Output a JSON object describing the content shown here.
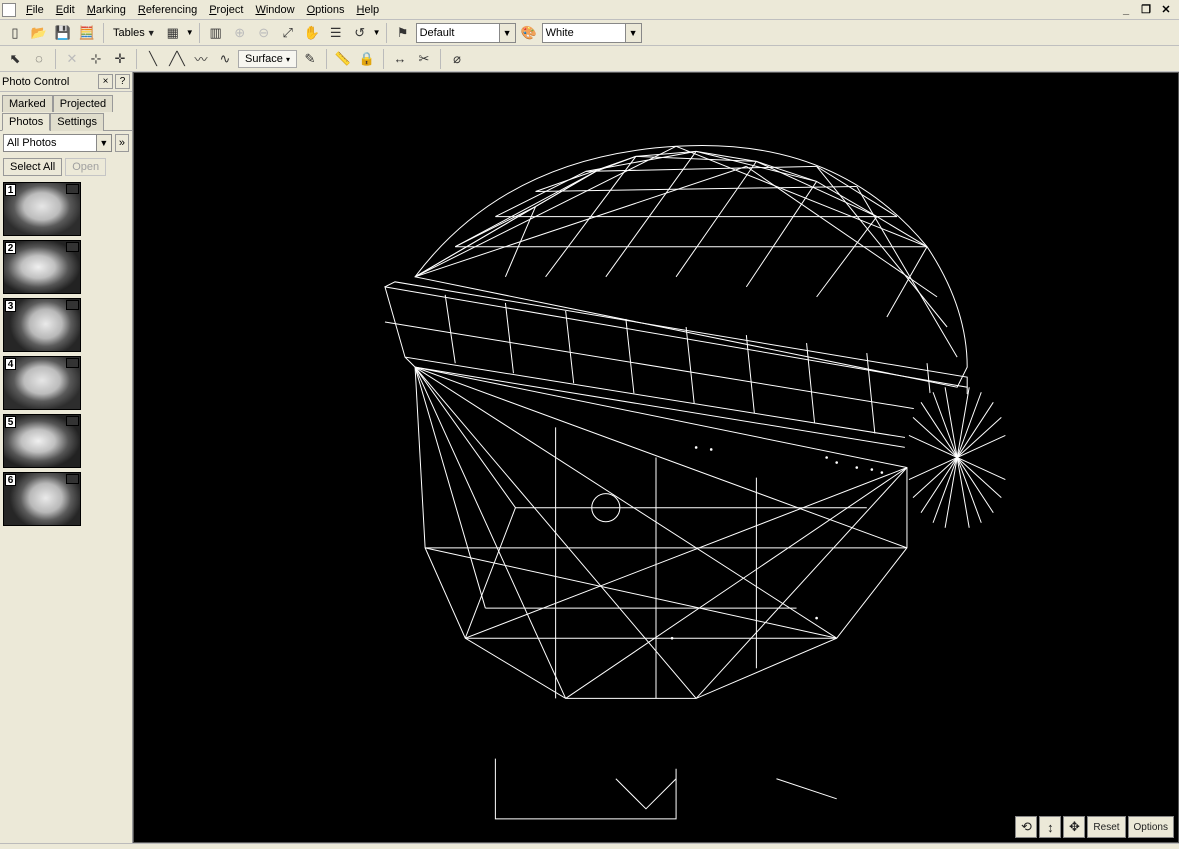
{
  "menu": {
    "items": [
      "File",
      "Edit",
      "Marking",
      "Referencing",
      "Project",
      "Window",
      "Options",
      "Help"
    ]
  },
  "toolbar1": {
    "tables_label": "Tables",
    "default_combo": "Default",
    "white_combo": "White"
  },
  "toolbar2": {
    "surface_label": "Surface"
  },
  "side_panel": {
    "title": "Photo Control",
    "tabs_top": [
      "Marked",
      "Projected"
    ],
    "tabs_bottom": [
      "Photos",
      "Settings"
    ],
    "filter_combo": "All Photos",
    "select_all": "Select All",
    "open": "Open",
    "thumbs": [
      {
        "num": "1"
      },
      {
        "num": "2"
      },
      {
        "num": "3"
      },
      {
        "num": "4"
      },
      {
        "num": "5"
      },
      {
        "num": "6"
      }
    ]
  },
  "viewport_controls": {
    "reset": "Reset",
    "options": "Options"
  }
}
